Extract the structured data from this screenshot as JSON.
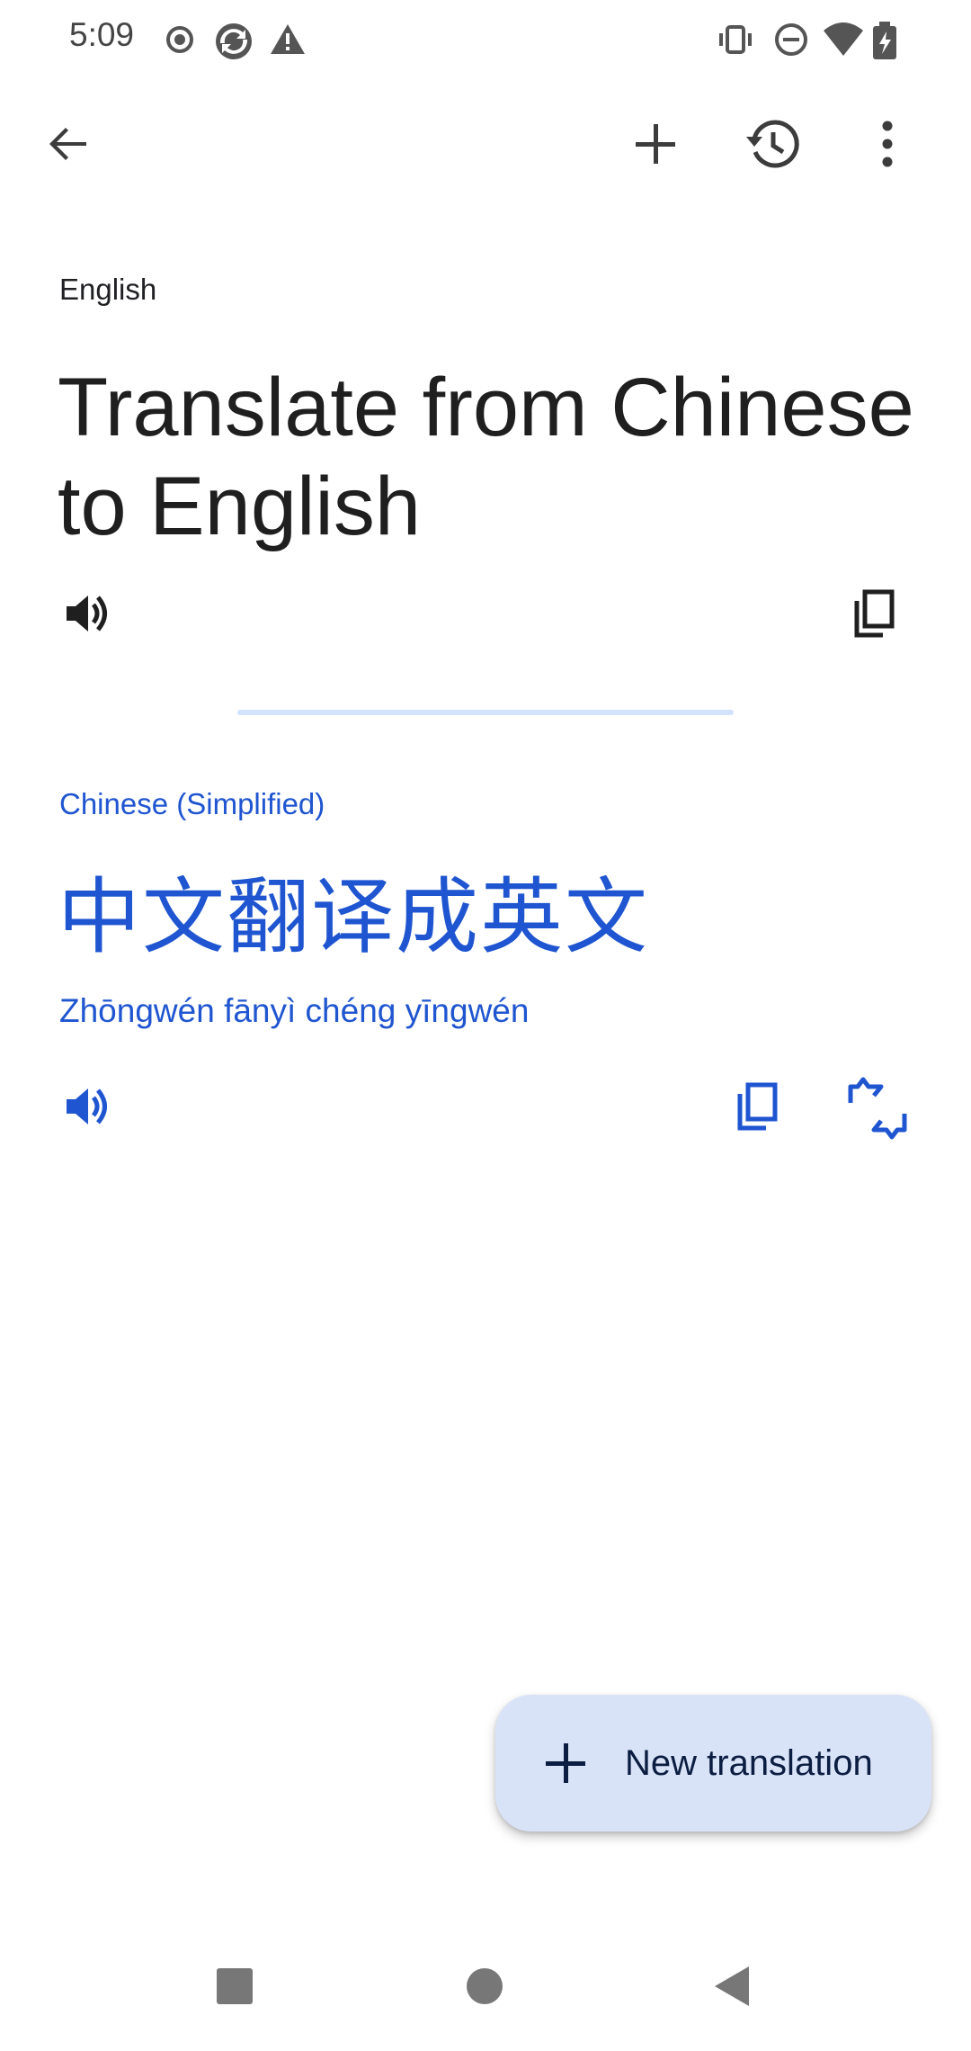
{
  "status_bar": {
    "time": "5:09",
    "left_icons": [
      "record-icon",
      "sync-icon",
      "warning-icon"
    ],
    "right_icons": [
      "vibrate-icon",
      "do-not-disturb-icon",
      "wifi-icon",
      "battery-charging-icon"
    ]
  },
  "app_bar": {
    "icons": [
      "back-arrow-icon",
      "add-icon",
      "history-icon",
      "more-vert-icon"
    ]
  },
  "target": {
    "language": "English",
    "text": "Translate from Chinese to English",
    "icons": [
      "speaker-icon",
      "copy-icon"
    ]
  },
  "source": {
    "language": "Chinese (Simplified)",
    "text": "中文翻译成英文",
    "romanization": "Zhōngwén fānyì chéng yīngwén",
    "icons": [
      "speaker-icon",
      "copy-icon",
      "swap-icon"
    ]
  },
  "fab": {
    "label": "New translation",
    "icon": "add-icon"
  },
  "nav_bar": {
    "icons": [
      "recents-square-icon",
      "home-circle-icon",
      "back-triangle-icon"
    ]
  },
  "colors": {
    "accent": "#1f55d0",
    "fab_bg": "#d9e3f8",
    "divider": "#d3e3fd",
    "text_dark": "#1f1f1f"
  }
}
